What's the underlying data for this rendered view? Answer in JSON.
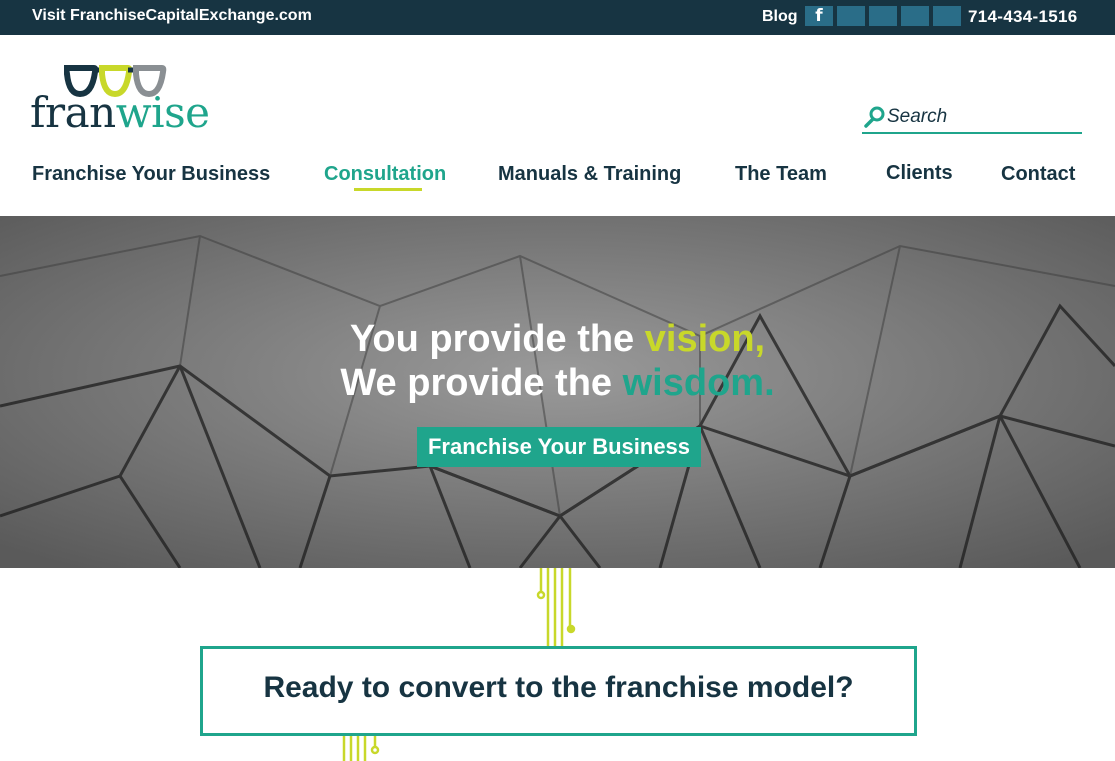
{
  "topbar": {
    "visit_text": "Visit FranchiseCapitalExchange.com",
    "blog": "Blog",
    "facebook_glyph": "f",
    "social_icons": [
      "facebook-icon",
      "social-icon",
      "social-icon",
      "social-icon",
      "social-icon"
    ],
    "phone": "714-434-1516"
  },
  "logo": {
    "part1": "fran",
    "part2": "wise"
  },
  "search": {
    "placeholder": "Search"
  },
  "nav": {
    "items": [
      {
        "label": "Franchise Your Business"
      },
      {
        "label": "Consultation",
        "active": true
      },
      {
        "label": "Manuals & Training"
      },
      {
        "label": "The Team"
      },
      {
        "label": "Clients"
      },
      {
        "label": "Contact"
      }
    ]
  },
  "hero": {
    "line1_prefix": "You provide the ",
    "line1_highlight": "vision,",
    "line2_prefix": "We provide the ",
    "line2_highlight": "wisdom.",
    "cta": "Franchise Your Business"
  },
  "section": {
    "heading": "Ready to convert to the franchise model?"
  },
  "colors": {
    "navy": "#173442",
    "teal": "#1fa58c",
    "lime": "#c8d82a",
    "social": "#2a6d88"
  }
}
